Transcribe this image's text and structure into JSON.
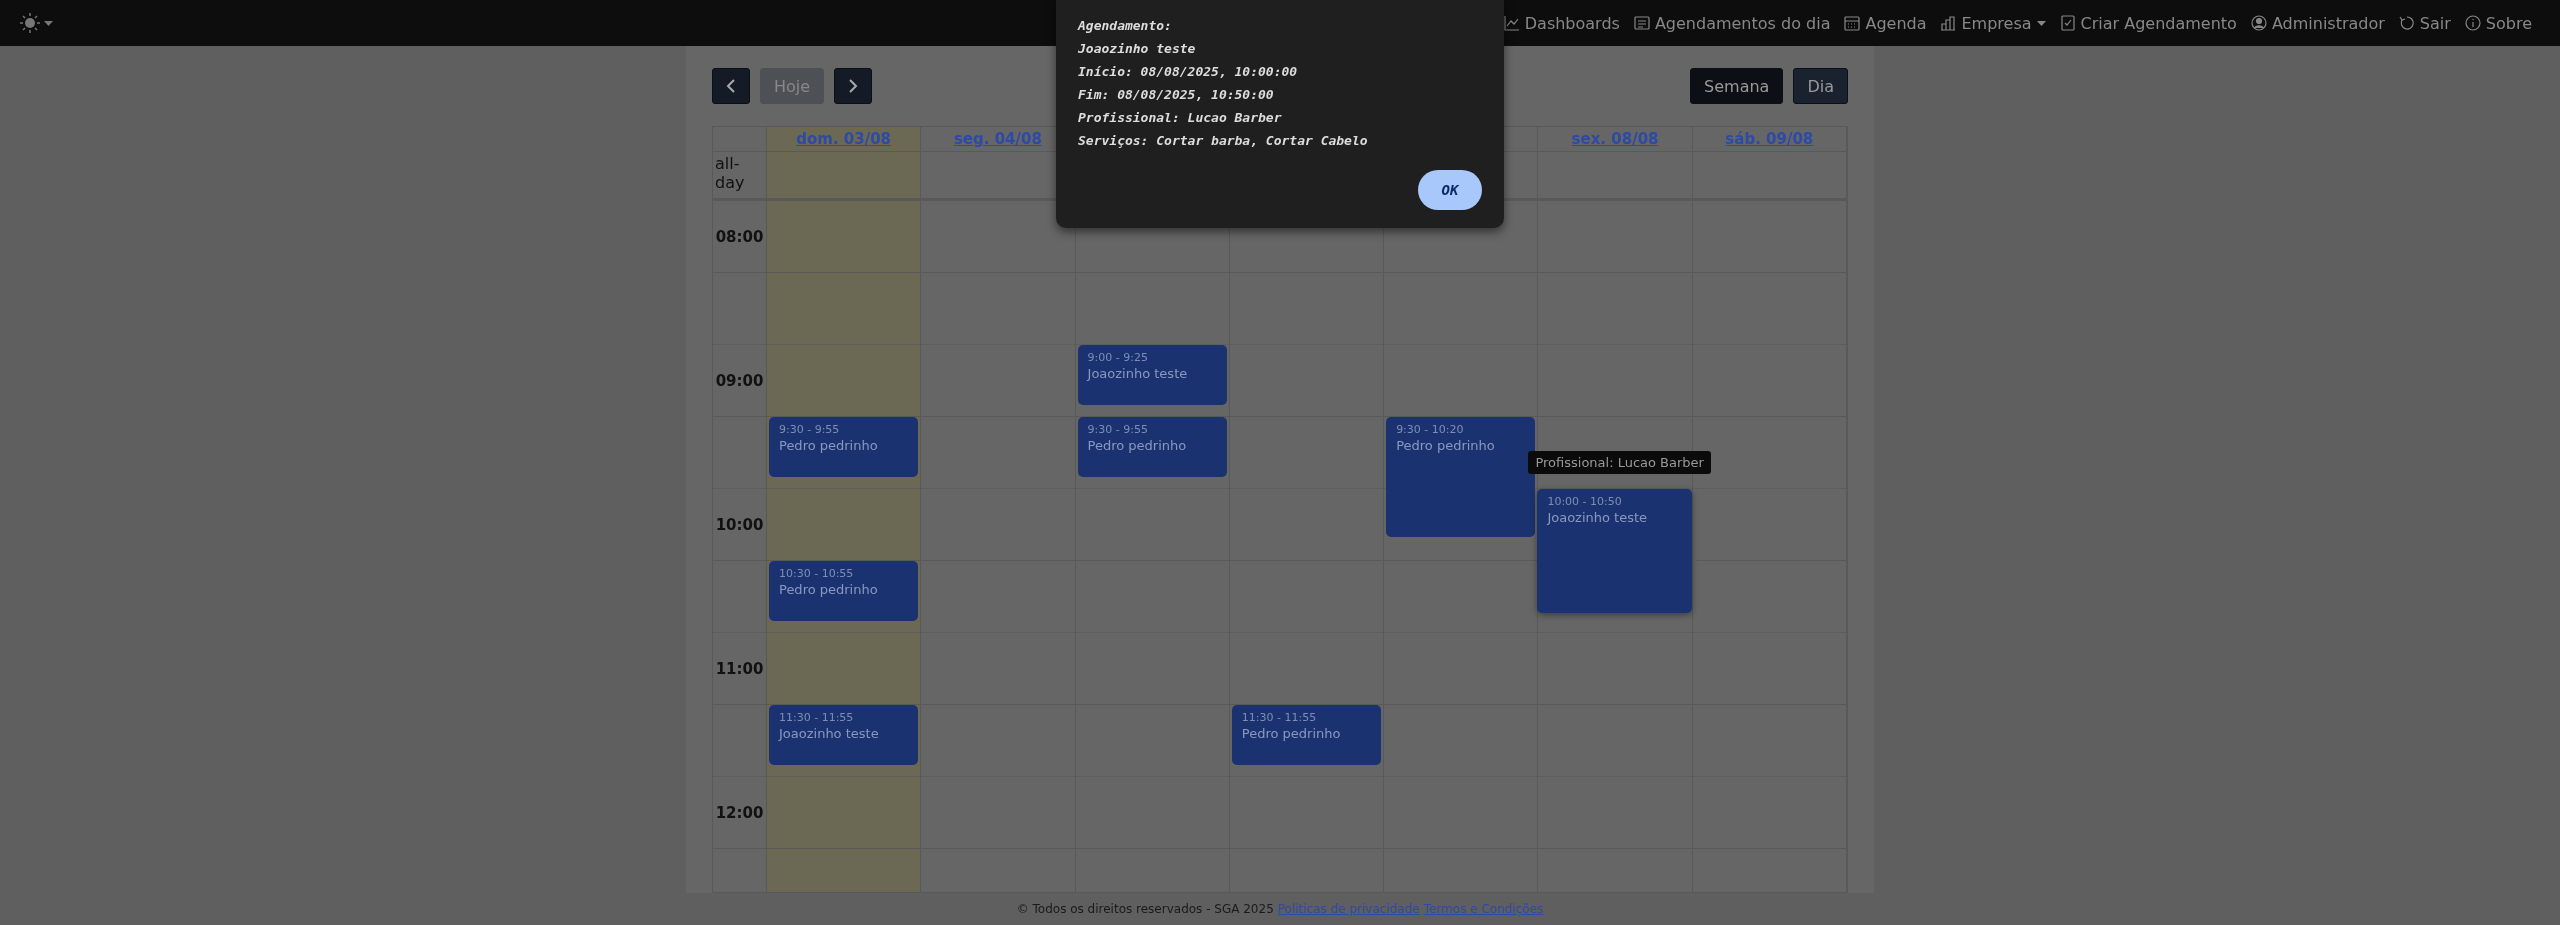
{
  "nav": {
    "theme_toggle": {
      "on": true
    },
    "items": [
      {
        "label": "Dashboards",
        "dropdown": false
      },
      {
        "label": "Agendamentos do dia",
        "dropdown": false
      },
      {
        "label": "Agenda",
        "dropdown": false
      },
      {
        "label": "Empresa",
        "dropdown": true
      },
      {
        "label": "Criar Agendamento",
        "dropdown": false
      },
      {
        "label": "Administrador",
        "dropdown": false
      },
      {
        "label": "Sair",
        "dropdown": false
      },
      {
        "label": "Sobre",
        "dropdown": false
      }
    ]
  },
  "toolbar": {
    "today": {
      "label": "Hoje",
      "disabled": true
    },
    "views": [
      {
        "label": "Semana",
        "selected": true
      },
      {
        "label": "Dia",
        "selected": false
      }
    ]
  },
  "calendar": {
    "all_day_label": "all-day",
    "hours": [
      "08:00",
      "09:00",
      "10:00",
      "11:00",
      "12:00"
    ],
    "days": [
      {
        "label": "dom. 03/08",
        "today": true,
        "events": [
          {
            "time": "9:30 - 9:55",
            "title": "Pedro pedrinho"
          },
          {
            "time": "10:30 - 10:55",
            "title": "Pedro pedrinho"
          },
          {
            "time": "11:30 - 11:55",
            "title": "Joaozinho teste"
          }
        ]
      },
      {
        "label": "seg. 04/08",
        "today": false
      },
      {
        "today": false,
        "events": [
          {
            "time": "9:00 - 9:25",
            "title": "Joaozinho teste"
          },
          {
            "time": "9:30 - 9:55",
            "title": "Pedro pedrinho"
          }
        ]
      },
      {
        "today": false,
        "events": [
          {
            "time": "11:30 - 11:55",
            "title": "Pedro pedrinho"
          }
        ]
      },
      {
        "today": false,
        "events": [
          {
            "time": "9:30 - 10:20",
            "title": "Pedro pedrinho"
          }
        ]
      },
      {
        "label": "sex. 08/08",
        "today": false,
        "events": [
          {
            "time": "10:00 - 10:50",
            "title": "Joaozinho teste",
            "tooltip": "Profissional: Lucao Barber"
          }
        ]
      },
      {
        "label": "sáb. 09/08",
        "today": false
      }
    ]
  },
  "dialog": {
    "lines": [
      "Agendamento:",
      "Joaozinho teste",
      "Início: 08/08/2025, 10:00:00",
      "Fim: 08/08/2025, 10:50:00",
      "Profissional: Lucao Barber",
      "Serviços: Cortar barba, Cortar Cabelo"
    ],
    "button": "OK"
  },
  "footer": {
    "text": "© Todos os direitos reservados - SGA 2025",
    "links": [
      "Politicas de privacidade",
      "Termos e Condições"
    ]
  }
}
